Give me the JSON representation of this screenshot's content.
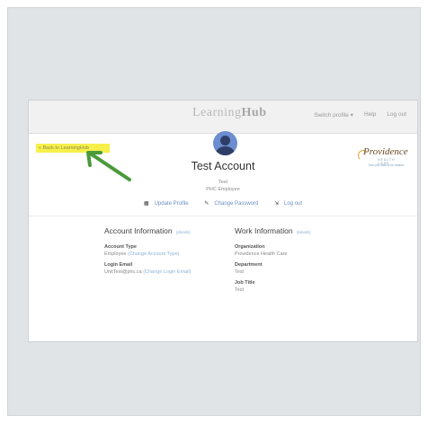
{
  "header": {
    "brand_light": "Learning",
    "brand_bold": "Hub",
    "switch_profile": "Switch profile ▾",
    "help": "Help",
    "logout": "Log out"
  },
  "back_link": "« Back to LearningHub",
  "logo": {
    "name": "Providence",
    "line1": "HEALTH CARE",
    "line2": "How you want to be treated."
  },
  "account": {
    "name": "Test Account",
    "sub1": "Test",
    "sub2": "PHC Employee"
  },
  "actions": {
    "update_profile": "Update Profile",
    "change_password": "Change Password",
    "log_out": "Log out"
  },
  "account_info": {
    "title": "Account Information",
    "edit": "(details)",
    "type_label": "Account Type",
    "type_value": "Employee",
    "type_link": "(Change Account Type)",
    "email_label": "Login Email",
    "email_value": "UnitTest@phc.ca",
    "email_link": "(Change Login Email)"
  },
  "work_info": {
    "title": "Work Information",
    "edit": "(details)",
    "org_label": "Organization",
    "org_value": "Providence Health Care",
    "dept_label": "Department",
    "dept_value": "Test",
    "job_label": "Job Title",
    "job_value": "Test"
  },
  "colors": {
    "highlight": "#f7f04a",
    "arrow": "#4a9a3a",
    "link": "#8db3d8",
    "avatar": "#6c8ed0"
  }
}
